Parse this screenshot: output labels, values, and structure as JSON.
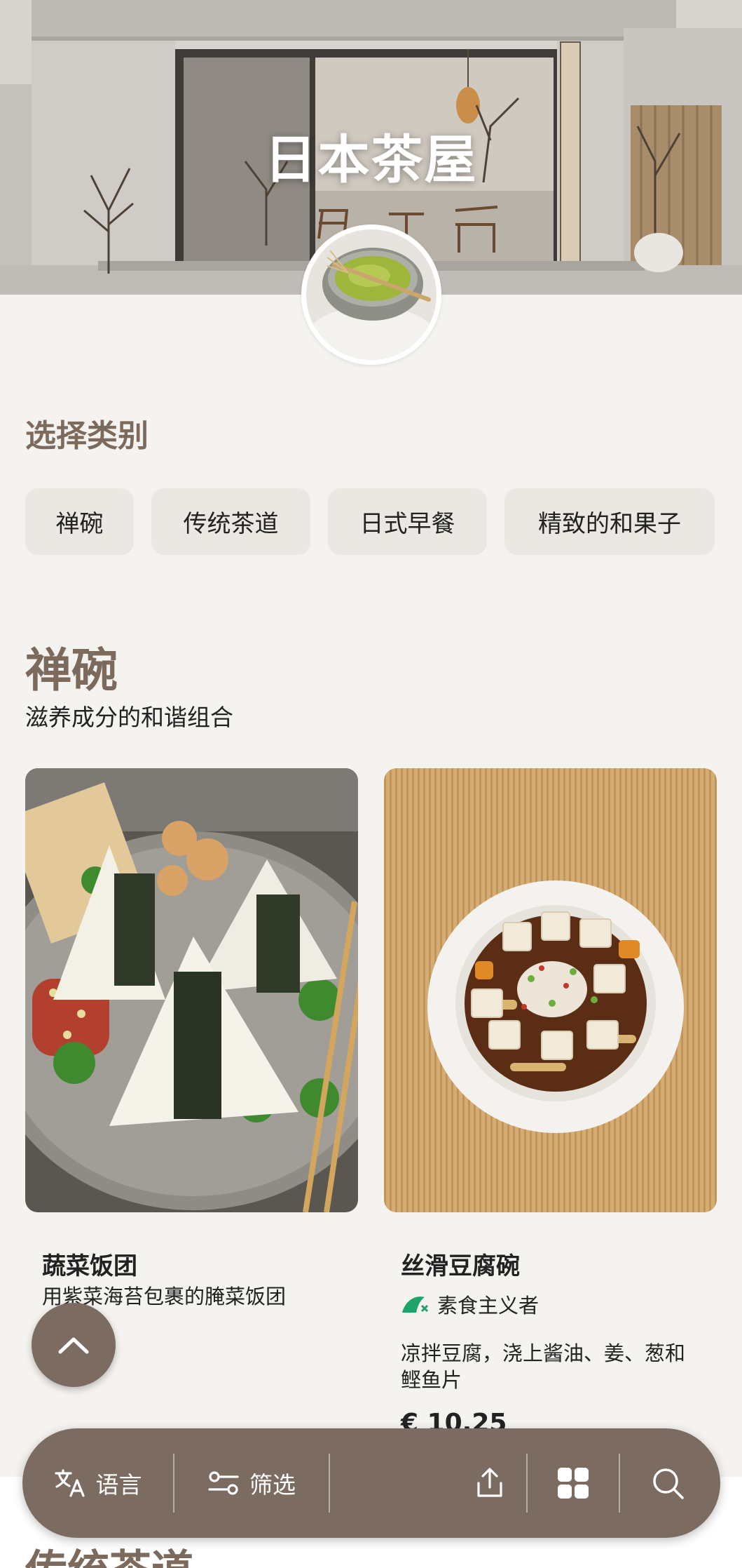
{
  "hero": {
    "title": "日本茶屋"
  },
  "category": {
    "title": "选择类别",
    "chips": [
      "禅碗",
      "传统茶道",
      "日式早餐",
      "精致的和果子"
    ]
  },
  "section": {
    "title": "禅碗",
    "subtitle": "滋养成分的和谐组合"
  },
  "cards": [
    {
      "name": "蔬菜饭团",
      "description": "用紫菜海苔包裹的腌菜饭团",
      "price": ""
    },
    {
      "name": "丝滑豆腐碗",
      "tag": "素食主义者",
      "description_lines": [
        "凉拌豆腐，浇上酱油、姜、葱和",
        "鲣鱼片"
      ],
      "price": "€ 10.25"
    }
  ],
  "bottom_bar": {
    "language_label": "语言",
    "filter_label": "筛选"
  },
  "next_section": {
    "title": "传统茶道"
  },
  "colors": {
    "accent": "#7b6b61",
    "heading": "#7c6a5d",
    "background": "#f5f3ef",
    "vegan_green": "#1fa36b"
  }
}
